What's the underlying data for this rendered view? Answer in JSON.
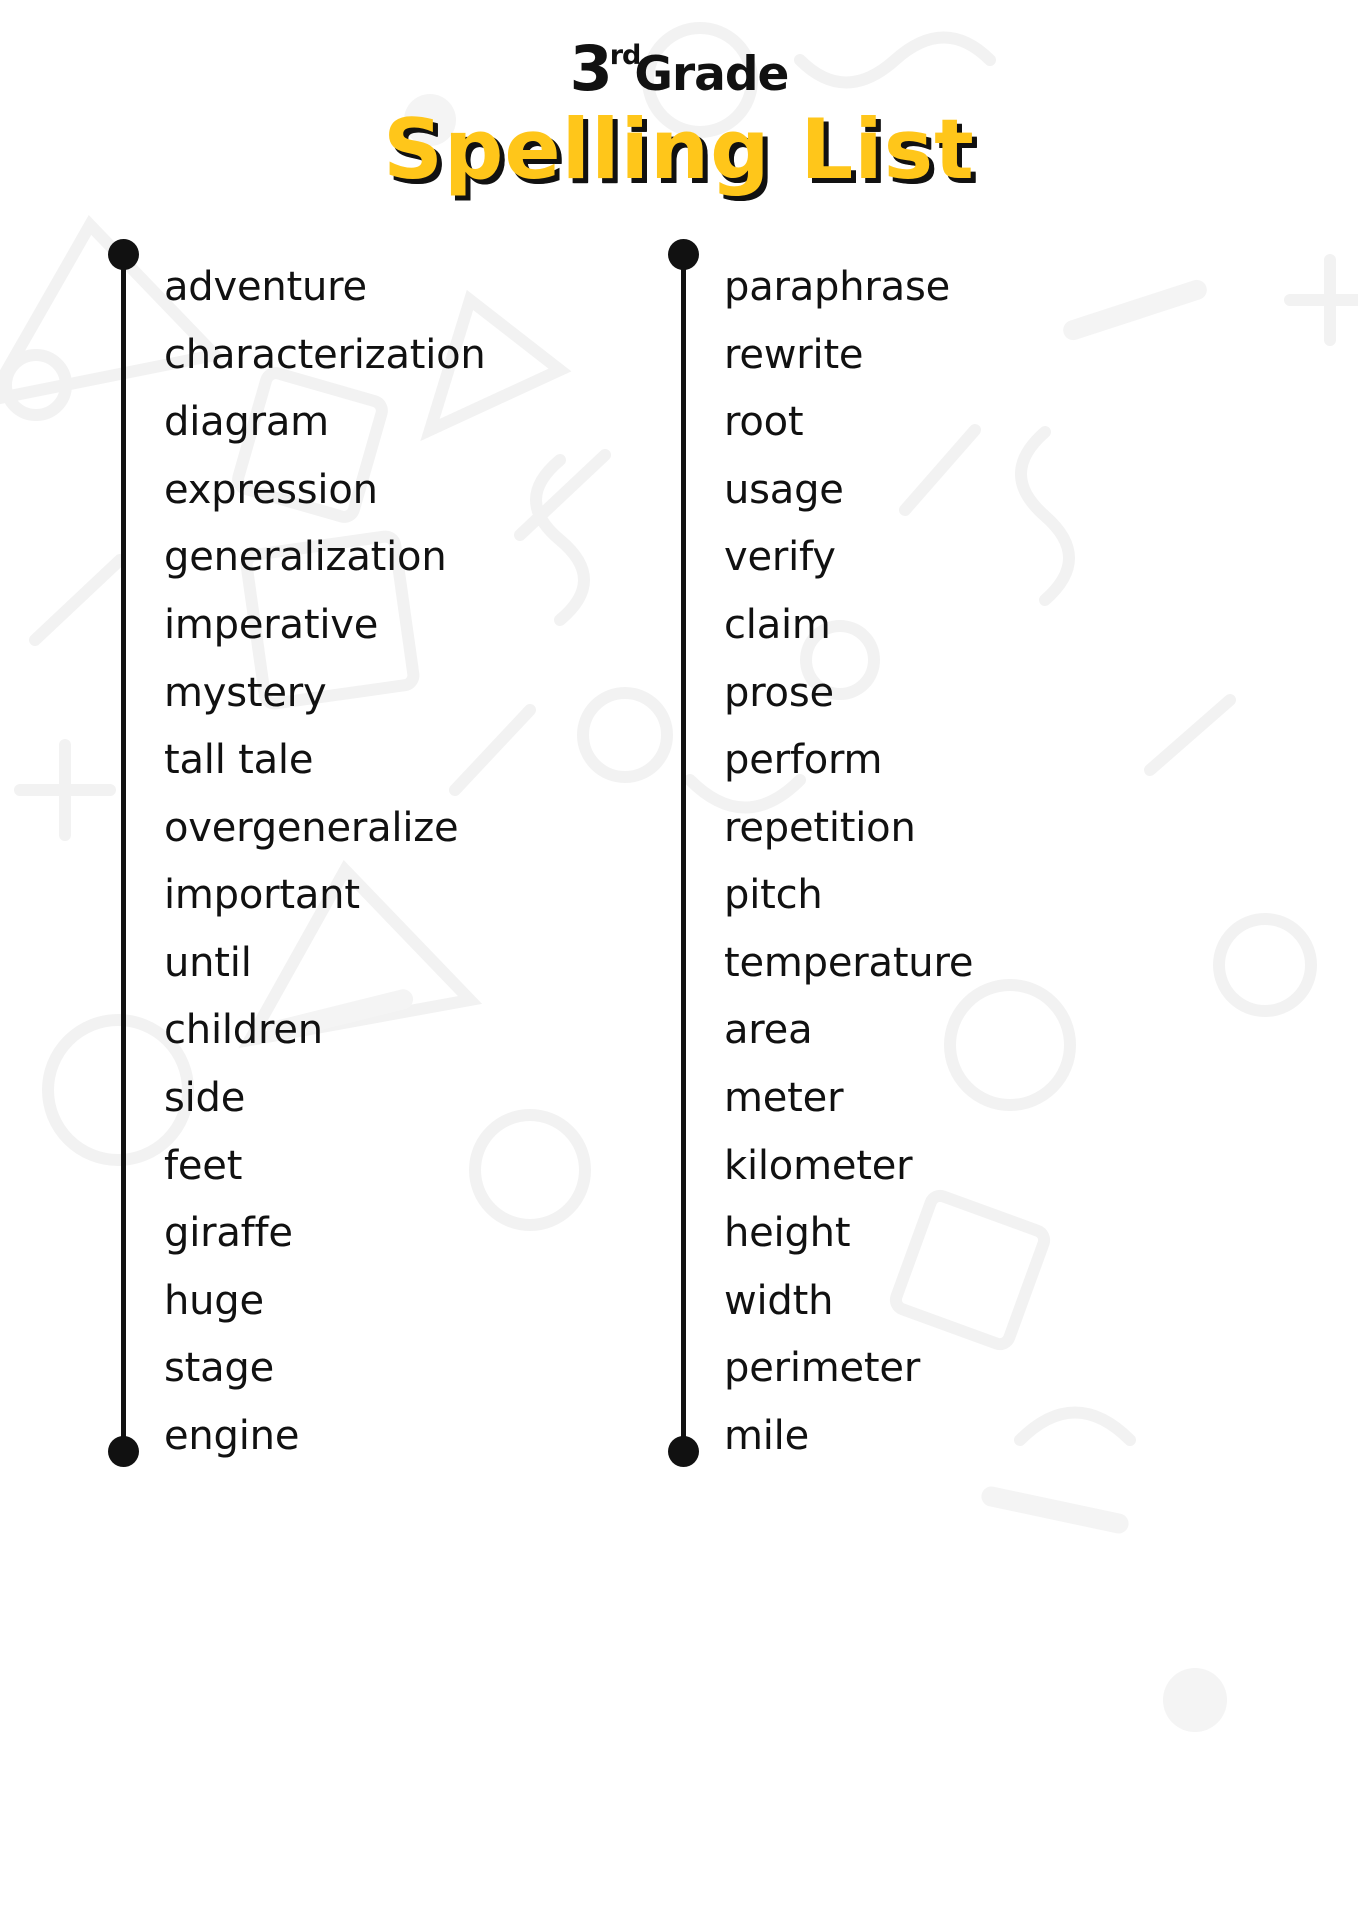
{
  "header": {
    "grade_number": "3",
    "grade_ordinal": "rd",
    "grade_word": "Grade",
    "title": "Spelling List",
    "title_color": "#FFC61A",
    "shadow_color": "#111111"
  },
  "columns": [
    {
      "name": "left-column",
      "words": [
        "adventure",
        "characterization",
        "diagram",
        "expression",
        "generalization",
        "imperative",
        "mystery",
        "tall tale",
        "overgeneralize",
        "important",
        "until",
        "children",
        "side",
        "feet",
        "giraffe",
        "huge",
        "stage",
        "engine"
      ]
    },
    {
      "name": "right-column",
      "words": [
        "paraphrase",
        "rewrite",
        "root",
        "usage",
        "verify",
        "claim",
        "prose",
        "perform",
        "repetition",
        "pitch",
        "temperature",
        "area",
        "meter",
        "kilometer",
        "height",
        "width",
        "perimeter",
        "mile"
      ]
    }
  ]
}
